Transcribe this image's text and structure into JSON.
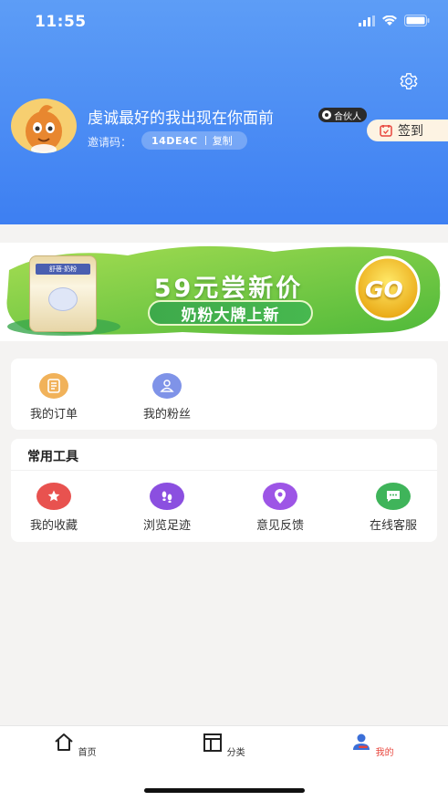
{
  "status_bar": {
    "time": "11:55"
  },
  "profile": {
    "name": "虔诚最好的我出现在你面前",
    "badge": "合伙人",
    "invite_label": "邀请码：",
    "invite_code": "14DE4C",
    "copy_label": "复制",
    "signin_label": "签到"
  },
  "banner": {
    "headline": "59元尝新价",
    "subline": "奶粉大牌上新",
    "go_label": "GO",
    "product_label": "舒蓓·奶粉"
  },
  "orders_panel": {
    "items": [
      {
        "label": "我的订单",
        "icon": "order-list-icon"
      },
      {
        "label": "我的粉丝",
        "icon": "fans-icon"
      }
    ]
  },
  "tools_panel": {
    "title": "常用工具",
    "items": [
      {
        "label": "我的收藏",
        "icon": "star-icon"
      },
      {
        "label": "浏览足迹",
        "icon": "footprint-icon"
      },
      {
        "label": "意见反馈",
        "icon": "feedback-icon"
      },
      {
        "label": "在线客服",
        "icon": "chat-icon"
      }
    ]
  },
  "tabbar": {
    "tabs": [
      {
        "label": "首页",
        "icon": "home-icon"
      },
      {
        "label": "分类",
        "icon": "category-icon"
      },
      {
        "label": "我的",
        "icon": "user-icon"
      }
    ],
    "active_color": "#e8453c"
  },
  "colors": {
    "header": "#4a8cf4",
    "accent": "#e8453c"
  }
}
